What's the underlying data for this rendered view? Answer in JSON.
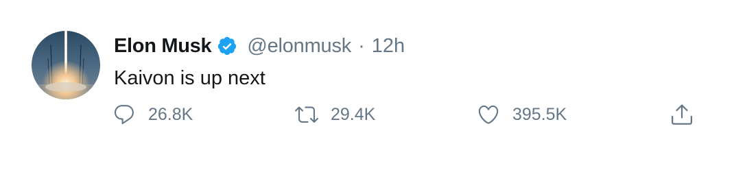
{
  "tweet": {
    "author": {
      "name": "Elon Musk",
      "handle": "@elonmusk",
      "verified": true
    },
    "time": "12h",
    "separator": "·",
    "text": "Kaivon is up next",
    "actions": {
      "reply": {
        "icon": "reply-icon",
        "count": "26.8K"
      },
      "retweet": {
        "icon": "retweet-icon",
        "count": "29.4K"
      },
      "like": {
        "icon": "heart-icon",
        "count": "395.5K"
      },
      "share": {
        "icon": "share-icon"
      }
    }
  },
  "colors": {
    "text_primary": "#14171a",
    "text_secondary": "#657786",
    "verified_blue": "#1da1f2"
  }
}
